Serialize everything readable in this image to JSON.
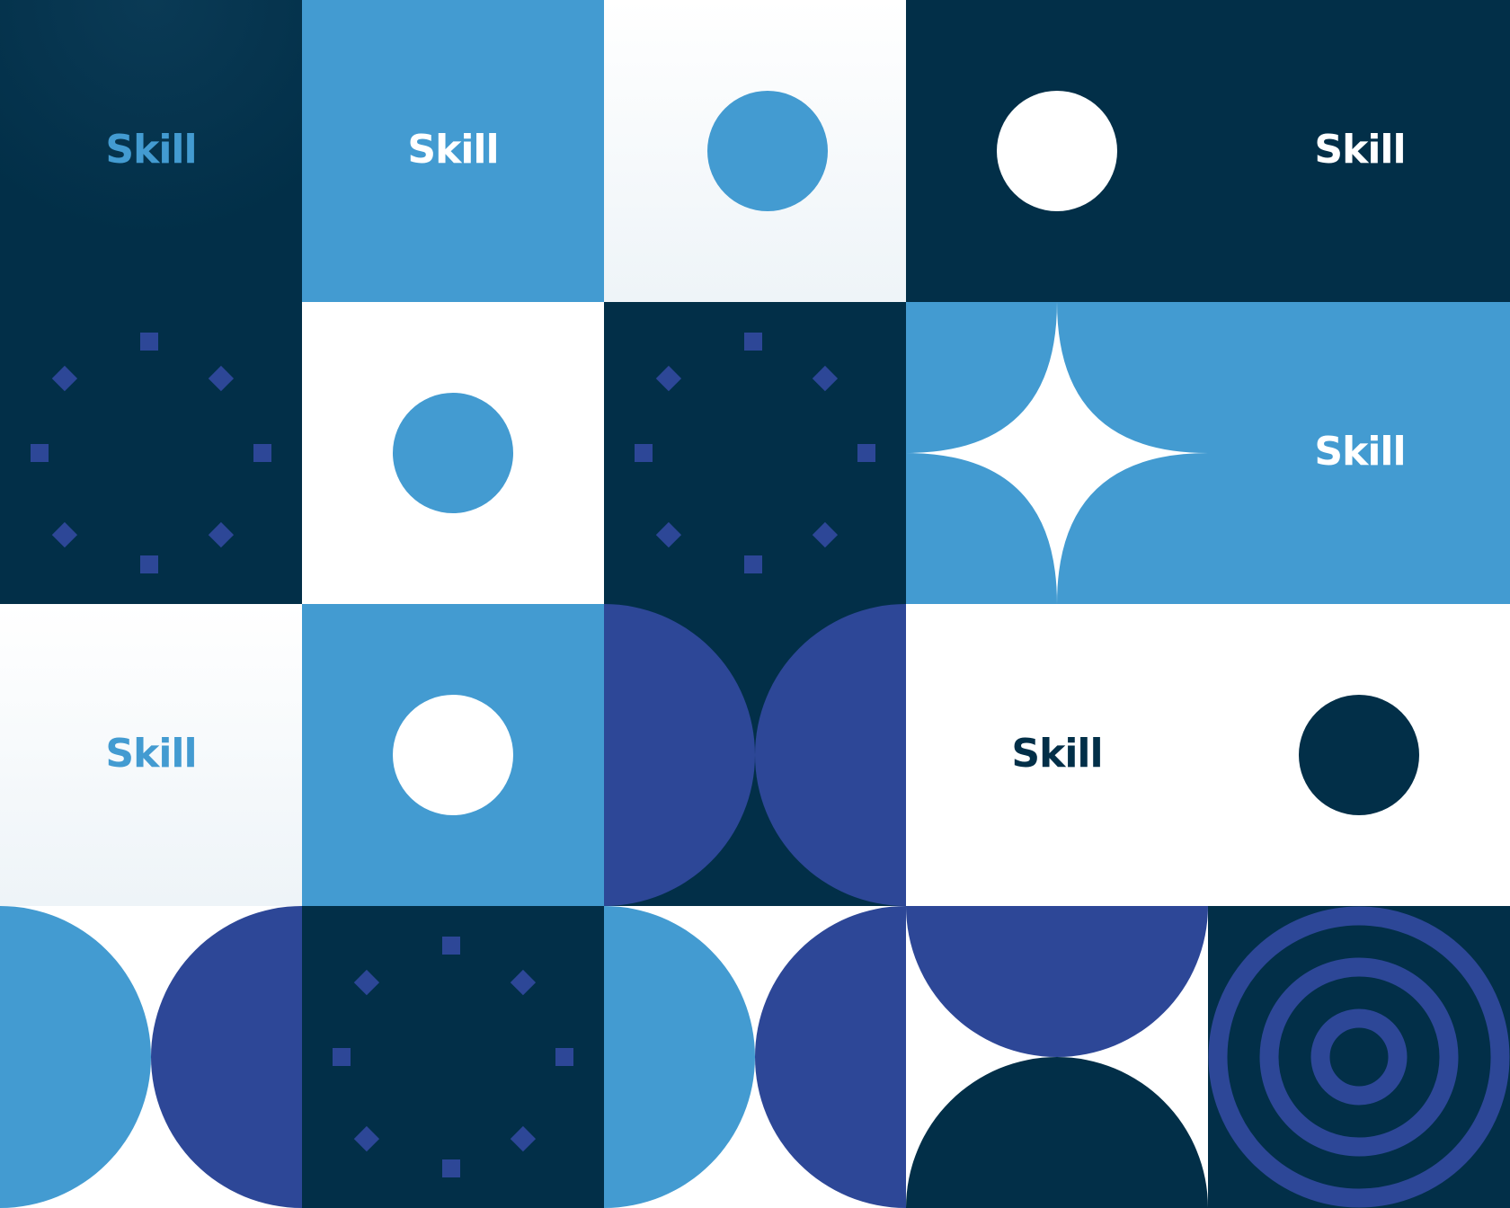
{
  "word": "Skill",
  "colors": {
    "navy": "#022f48",
    "blue": "#439bd1",
    "indigo": "#2d4797",
    "white": "#ffffff",
    "paper": "#eef4f8"
  },
  "labels": [
    {
      "id": "r1c1",
      "text": "Skill"
    },
    {
      "id": "r1c2",
      "text": "Skill"
    },
    {
      "id": "r1c45",
      "text": "Skill"
    },
    {
      "id": "r2c45",
      "text": "Skill"
    },
    {
      "id": "r3c1",
      "text": "Skill"
    },
    {
      "id": "r3c45",
      "text": "Skill"
    }
  ]
}
